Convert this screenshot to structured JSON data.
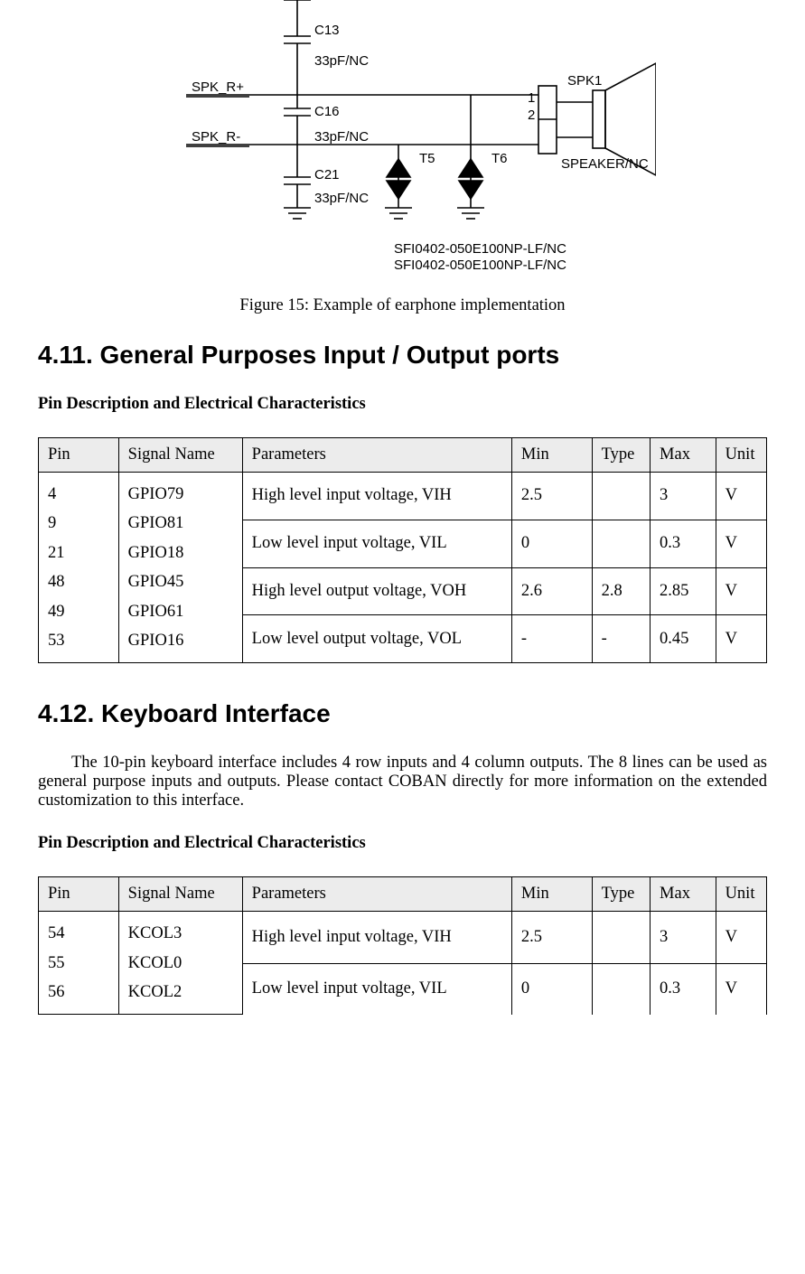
{
  "schematic": {
    "labels": {
      "c13": "C13",
      "c16": "C16",
      "c21": "C21",
      "cap_val": "33pF/NC",
      "spk_rp": "SPK_R+",
      "spk_rn": "SPK_R-",
      "t5": "T5",
      "t6": "T6",
      "spk1": "SPK1",
      "pin1": "1",
      "pin2": "2",
      "spk_note": "SPEAKER/NC",
      "tvs1": "SFI0402-050E100NP-LF/NC",
      "tvs2": "SFI0402-050E100NP-LF/NC"
    }
  },
  "figure_caption": "Figure 15: Example of earphone implementation",
  "section_411": {
    "title": "4.11. General Purposes Input / Output ports",
    "subhead": "Pin Description and Electrical Characteristics",
    "headers": {
      "pin": "Pin",
      "signal": "Signal Name",
      "params": "Parameters",
      "min": "Min",
      "type": "Type",
      "max": "Max",
      "unit": "Unit"
    },
    "pins_text": "4\n9\n21\n48\n49\n53",
    "signals_text": "GPIO79\nGPIO81\nGPIO18\nGPIO45\nGPIO61\nGPIO16",
    "rows": [
      {
        "param": "High level input voltage, VIH",
        "min": "2.5",
        "type": "",
        "max": "3",
        "unit": "V"
      },
      {
        "param": "Low level input voltage, VIL",
        "min": "0",
        "type": "",
        "max": "0.3",
        "unit": "V"
      },
      {
        "param": "High level output voltage, VOH",
        "min": "2.6",
        "type": "2.8",
        "max": "2.85",
        "unit": "V"
      },
      {
        "param": "Low level output voltage, VOL",
        "min": "-",
        "type": "-",
        "max": "0.45",
        "unit": "V"
      }
    ]
  },
  "section_412": {
    "title": "4.12. Keyboard Interface",
    "body": "The 10-pin keyboard interface includes 4 row inputs and 4 column outputs. The 8 lines can be used as general purpose inputs and outputs. Please contact COBAN directly for more information on the extended customization to this interface.",
    "subhead": "Pin Description and Electrical Characteristics",
    "headers": {
      "pin": "Pin",
      "signal": "Signal Name",
      "params": "Parameters",
      "min": "Min",
      "type": "Type",
      "max": "Max",
      "unit": "Unit"
    },
    "pins_text": "54\n55\n56",
    "signals_text": "KCOL3\nKCOL0\nKCOL2",
    "rows": [
      {
        "param": "High level input voltage, VIH",
        "min": "2.5",
        "type": "",
        "max": "3",
        "unit": "V"
      },
      {
        "param": "Low level input voltage, VIL",
        "min": "0",
        "type": "",
        "max": "0.3",
        "unit": "V"
      }
    ]
  }
}
